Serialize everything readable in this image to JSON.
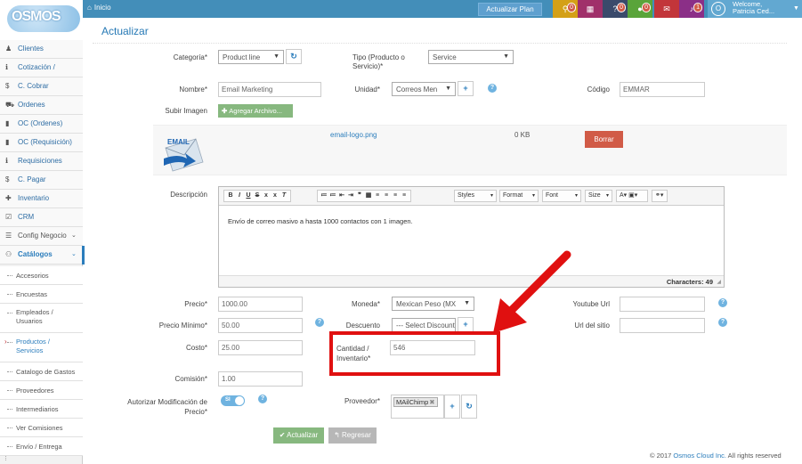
{
  "topbar": {
    "logo_text": "OSMOS",
    "home_label": "Inicio",
    "upgrade_label": "Actualizar Plan",
    "badges": [
      {
        "icon": "map-marker-icon",
        "count": "0",
        "color": "#d4a017"
      },
      {
        "icon": "calendar-icon",
        "count": "",
        "color": "#a0306a"
      },
      {
        "icon": "question-icon",
        "count": "0",
        "color": "#3a4a6b"
      },
      {
        "icon": "chat-icon",
        "count": "0",
        "color": "#5aa43a"
      },
      {
        "icon": "envelope-icon",
        "count": "",
        "color": "#c2353a"
      },
      {
        "icon": "bell-icon",
        "count": "1",
        "color": "#8b2f87"
      }
    ],
    "user_welcome": "Welcome,",
    "user_name": "Patricia Ced..."
  },
  "sidebar": {
    "items": [
      {
        "label": "Clientes",
        "icon": "user-icon"
      },
      {
        "label": "Cotización /",
        "icon": "info-icon"
      },
      {
        "label": "C. Cobrar",
        "icon": "dollar-icon"
      },
      {
        "label": "Ordenes",
        "icon": "cart-icon"
      },
      {
        "label": "OC (Ordenes)",
        "icon": "document-icon"
      },
      {
        "label": "OC (Requisición)",
        "icon": "document-icon"
      },
      {
        "label": "Requisiciones",
        "icon": "info-icon"
      },
      {
        "label": "C. Pagar",
        "icon": "dollar-icon"
      },
      {
        "label": "Inventario",
        "icon": "plus-icon"
      },
      {
        "label": "CRM",
        "icon": "check-square-icon"
      },
      {
        "label": "Config Negocio",
        "icon": "list-icon"
      },
      {
        "label": "Catálogos",
        "icon": "group-icon"
      }
    ],
    "subitems": [
      {
        "label": "Accesorios"
      },
      {
        "label": "Encuestas"
      },
      {
        "label": "Empleados / Usuarios"
      },
      {
        "label": "Productos / Servicios"
      },
      {
        "label": "Catalogo de Gastos"
      },
      {
        "label": "Proveedores"
      },
      {
        "label": "Intermediarios"
      },
      {
        "label": "Ver Comisiones"
      },
      {
        "label": "Envío / Entrega"
      }
    ]
  },
  "page": {
    "title": "Actualizar"
  },
  "form": {
    "categoria_label": "Categoría*",
    "categoria_value": "Product line",
    "tipo_label": "Tipo (Producto o Servicio)*",
    "tipo_value": "Service",
    "nombre_label": "Nombre*",
    "nombre_value": "Email Marketing",
    "unidad_label": "Unidad*",
    "unidad_value": "Correos Men",
    "codigo_label": "Código",
    "codigo_value": "EMMAR",
    "subir_label": "Subir Imagen",
    "agregar_label": "Agregar Archivo...",
    "file_name": "email-logo.png",
    "file_size": "0 KB",
    "borrar_label": "Borrar",
    "icon_text": "EMAIL",
    "descripcion_label": "Descripción",
    "descripcion_text": "Envío de correo masivo a hasta 1000 contactos con 1 imagen.",
    "char_count": "Characters: 49",
    "editor": {
      "styles": "Styles",
      "format": "Format",
      "font": "Font",
      "size": "Size"
    },
    "precio_label": "Precio*",
    "precio_value": "1000.00",
    "moneda_label": "Moneda*",
    "moneda_value": "Mexican Peso (MX",
    "youtube_label": "Youtube Url",
    "precio_min_label": "Precio Mínimo*",
    "precio_min_value": "50.00",
    "descuento_label": "Descuento",
    "descuento_value": "--- Select Discount",
    "url_label": "Url del sitio",
    "costo_label": "Costo*",
    "costo_value": "25.00",
    "cantidad_label": "Cantidad / Inventario*",
    "cantidad_value": "546",
    "comision_label": "Comisión*",
    "comision_value": "1.00",
    "autorizar_label": "Autorizar Modificación de Precio*",
    "toggle_text": "SI",
    "proveedor_label": "Proveedor*",
    "proveedor_tag": "MAilChimp"
  },
  "buttons": {
    "actualizar": "Actualizar",
    "regresar": "Regresar"
  },
  "footer": {
    "prefix": "© 2017",
    "brand": "Osmos Cloud Inc.",
    "suffix": "All rights reserved"
  },
  "colors": {
    "topbar": "#438eb9",
    "accent": "#2b7dbc",
    "success": "#87b87f",
    "danger": "#d15b47",
    "highlight": "#e01010"
  }
}
